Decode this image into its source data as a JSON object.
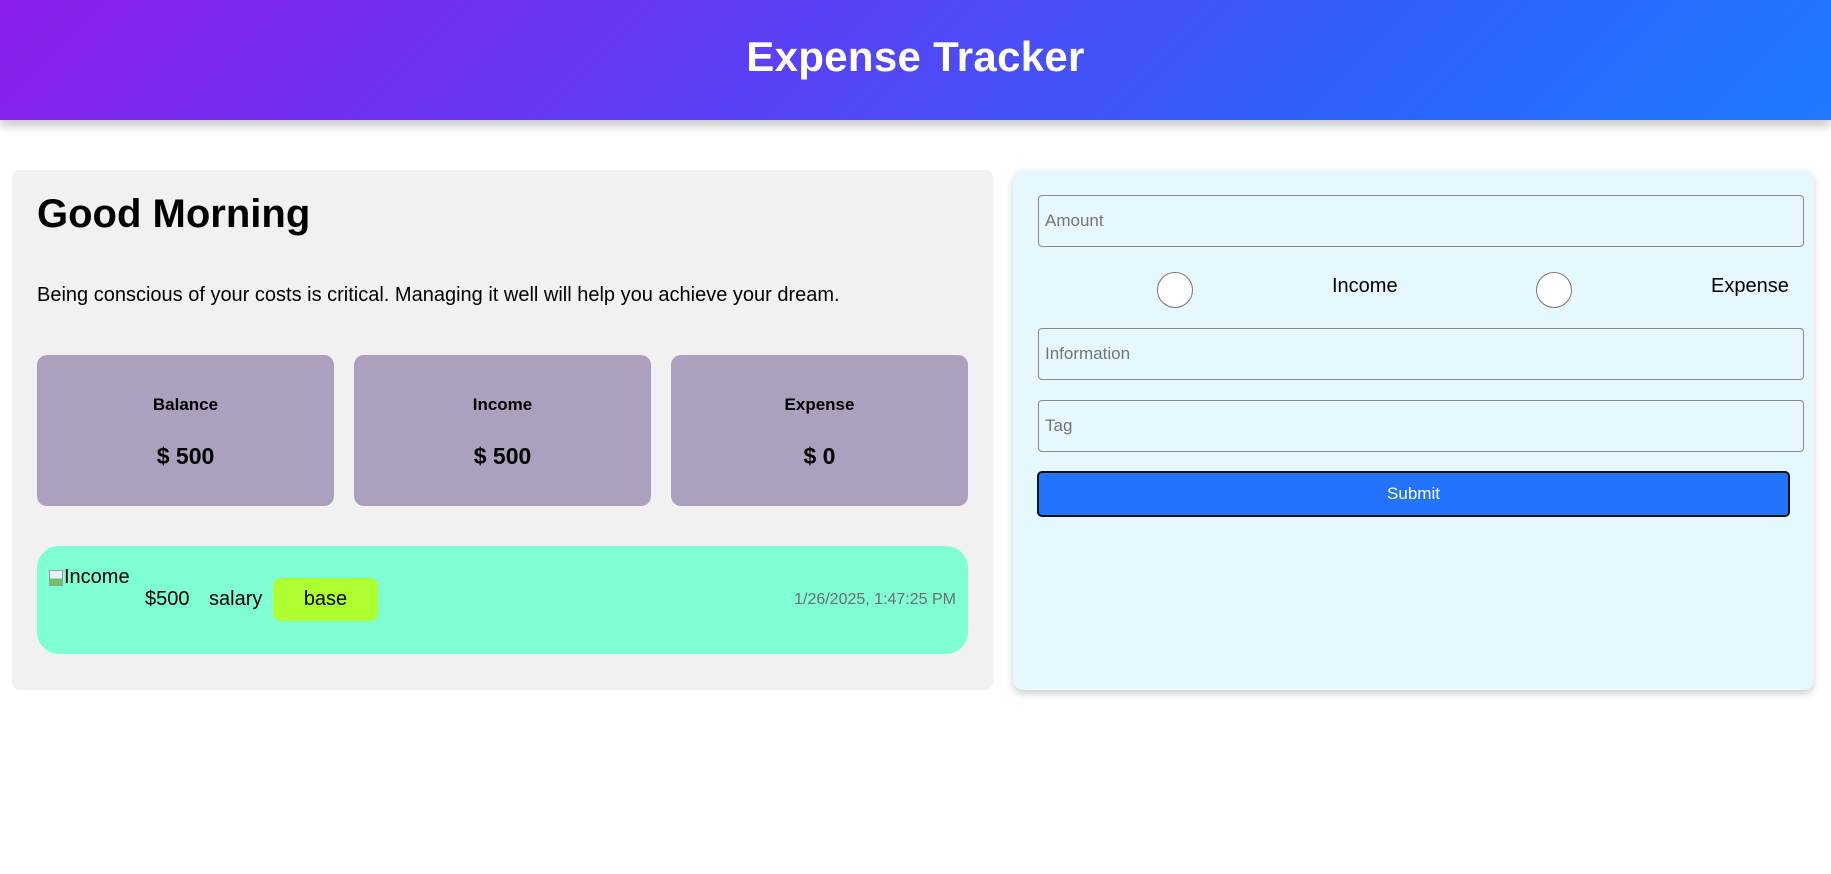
{
  "header": {
    "title": "Expense Tracker"
  },
  "summary": {
    "greeting": "Good Morning",
    "tagline": "Being conscious of your costs is critical. Managing it well will help you achieve your dream.",
    "cards": [
      {
        "label": "Balance",
        "value": "$ 500"
      },
      {
        "label": "Income",
        "value": "$ 500"
      },
      {
        "label": "Expense",
        "value": "$ 0"
      }
    ]
  },
  "transactions": [
    {
      "image_alt": "Income",
      "amount": "$500",
      "information": "salary",
      "tag": "base",
      "timestamp": "1/26/2025, 1:47:25 PM"
    }
  ],
  "form": {
    "amount_placeholder": "Amount",
    "amount_value": "",
    "type_options": [
      "Income",
      "Expense"
    ],
    "information_placeholder": "Information",
    "information_value": "",
    "tag_placeholder": "Tag",
    "tag_value": "",
    "submit_label": "Submit"
  },
  "colors": {
    "header_gradient_start": "#8a1ee9",
    "header_gradient_end": "#1e7bff",
    "card_bg": "#aca0bf",
    "transaction_bg": "#7fffd4",
    "tag_bg": "#adff2f",
    "form_bg": "#e6f8fe",
    "submit_bg": "#2374fd"
  },
  "icons": {
    "transaction_image": "broken-image-icon"
  }
}
